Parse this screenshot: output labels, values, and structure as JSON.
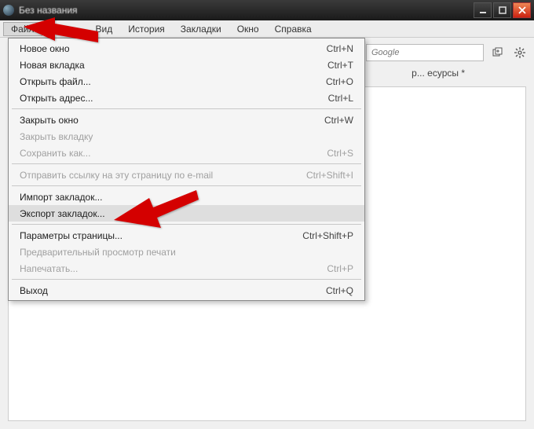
{
  "window": {
    "title": "Без названия"
  },
  "menubar": {
    "items": [
      {
        "label": "Файл",
        "active": true
      },
      {
        "label": "Вид",
        "active": false
      },
      {
        "label": "История",
        "active": false
      },
      {
        "label": "Закладки",
        "active": false
      },
      {
        "label": "Окно",
        "active": false
      },
      {
        "label": "Справка",
        "active": false
      }
    ]
  },
  "toolbar": {
    "search_placeholder": "Google"
  },
  "tab_remnant": "р... есурсы *",
  "dropdown": {
    "groups": [
      [
        {
          "label": "Новое окно",
          "shortcut": "Ctrl+N",
          "enabled": true
        },
        {
          "label": "Новая вкладка",
          "shortcut": "Ctrl+T",
          "enabled": true
        },
        {
          "label": "Открыть файл...",
          "shortcut": "Ctrl+O",
          "enabled": true
        },
        {
          "label": "Открыть адрес...",
          "shortcut": "Ctrl+L",
          "enabled": true
        }
      ],
      [
        {
          "label": "Закрыть окно",
          "shortcut": "Ctrl+W",
          "enabled": true
        },
        {
          "label": "Закрыть вкладку",
          "shortcut": "",
          "enabled": false
        },
        {
          "label": "Сохранить как...",
          "shortcut": "Ctrl+S",
          "enabled": false
        }
      ],
      [
        {
          "label": "Отправить ссылку на эту страницу по e-mail",
          "shortcut": "Ctrl+Shift+I",
          "enabled": false
        }
      ],
      [
        {
          "label": "Импорт закладок...",
          "shortcut": "",
          "enabled": true
        },
        {
          "label": "Экспорт закладок...",
          "shortcut": "",
          "enabled": true,
          "hover": true
        }
      ],
      [
        {
          "label": "Параметры страницы...",
          "shortcut": "Ctrl+Shift+P",
          "enabled": true
        },
        {
          "label": "Предварительный просмотр печати",
          "shortcut": "",
          "enabled": false
        },
        {
          "label": "Напечатать...",
          "shortcut": "Ctrl+P",
          "enabled": false
        }
      ],
      [
        {
          "label": "Выход",
          "shortcut": "Ctrl+Q",
          "enabled": true
        }
      ]
    ]
  },
  "colors": {
    "arrow": "#d40000"
  }
}
